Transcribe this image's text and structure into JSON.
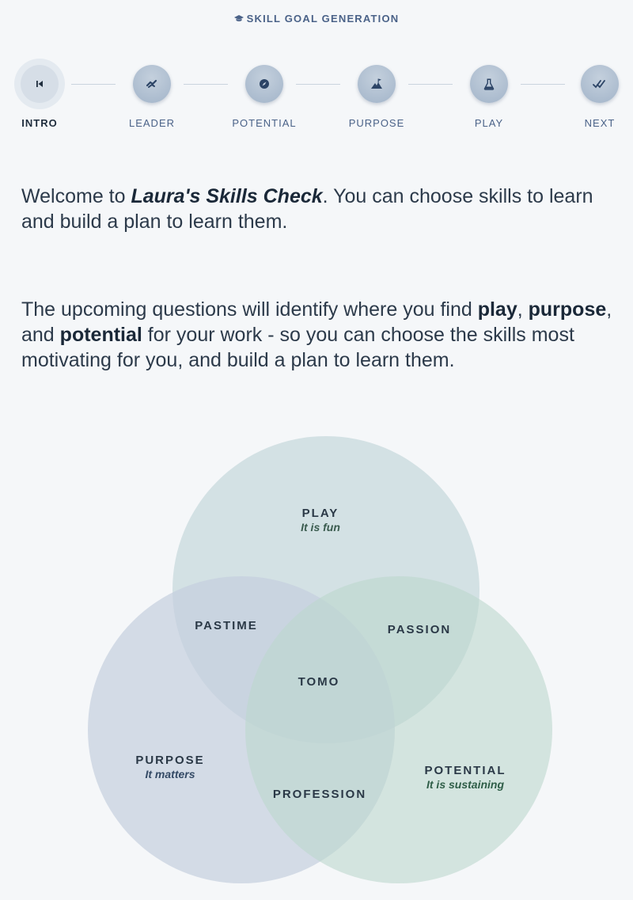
{
  "header": {
    "title": "SKILL GOAL GENERATION",
    "icon": "graduation-cap-icon"
  },
  "steps": [
    {
      "label": "INTRO",
      "icon": "skip-back-icon",
      "active": true
    },
    {
      "label": "LEADER",
      "icon": "handshake-icon",
      "active": false
    },
    {
      "label": "POTENTIAL",
      "icon": "compass-icon",
      "active": false
    },
    {
      "label": "PURPOSE",
      "icon": "mountain-flag-icon",
      "active": false
    },
    {
      "label": "PLAY",
      "icon": "flask-icon",
      "active": false
    },
    {
      "label": "NEXT",
      "icon": "double-check-icon",
      "active": false
    }
  ],
  "intro": {
    "p1_before": "Welcome to ",
    "p1_strong": "Laura's Skills Check",
    "p1_after": ". You can choose skills to learn and build a plan to learn them.",
    "p2_part1": "The upcoming questions will identify where you find ",
    "p2_play": "play",
    "p2_sep1": ", ",
    "p2_purpose": "purpose",
    "p2_sep2": ", and ",
    "p2_potential": "potential",
    "p2_part2": " for your work - so you can choose the skills most motivating for you, and build a plan to learn them."
  },
  "venn": {
    "play": {
      "title": "PLAY",
      "sub": "It is fun"
    },
    "purpose": {
      "title": "PURPOSE",
      "sub": "It matters"
    },
    "potential": {
      "title": "POTENTIAL",
      "sub": "It is sustaining"
    },
    "pastime": "PASTIME",
    "passion": "PASSION",
    "profession": "PROFESSION",
    "center": "TOMO",
    "colors": {
      "play": "#c4d7dc",
      "purpose": "#c5cfde",
      "potential": "#bcd7cd",
      "sub_play": "#3b5c4f",
      "sub_purpose": "#344a66",
      "sub_potential": "#2f5e48"
    }
  }
}
